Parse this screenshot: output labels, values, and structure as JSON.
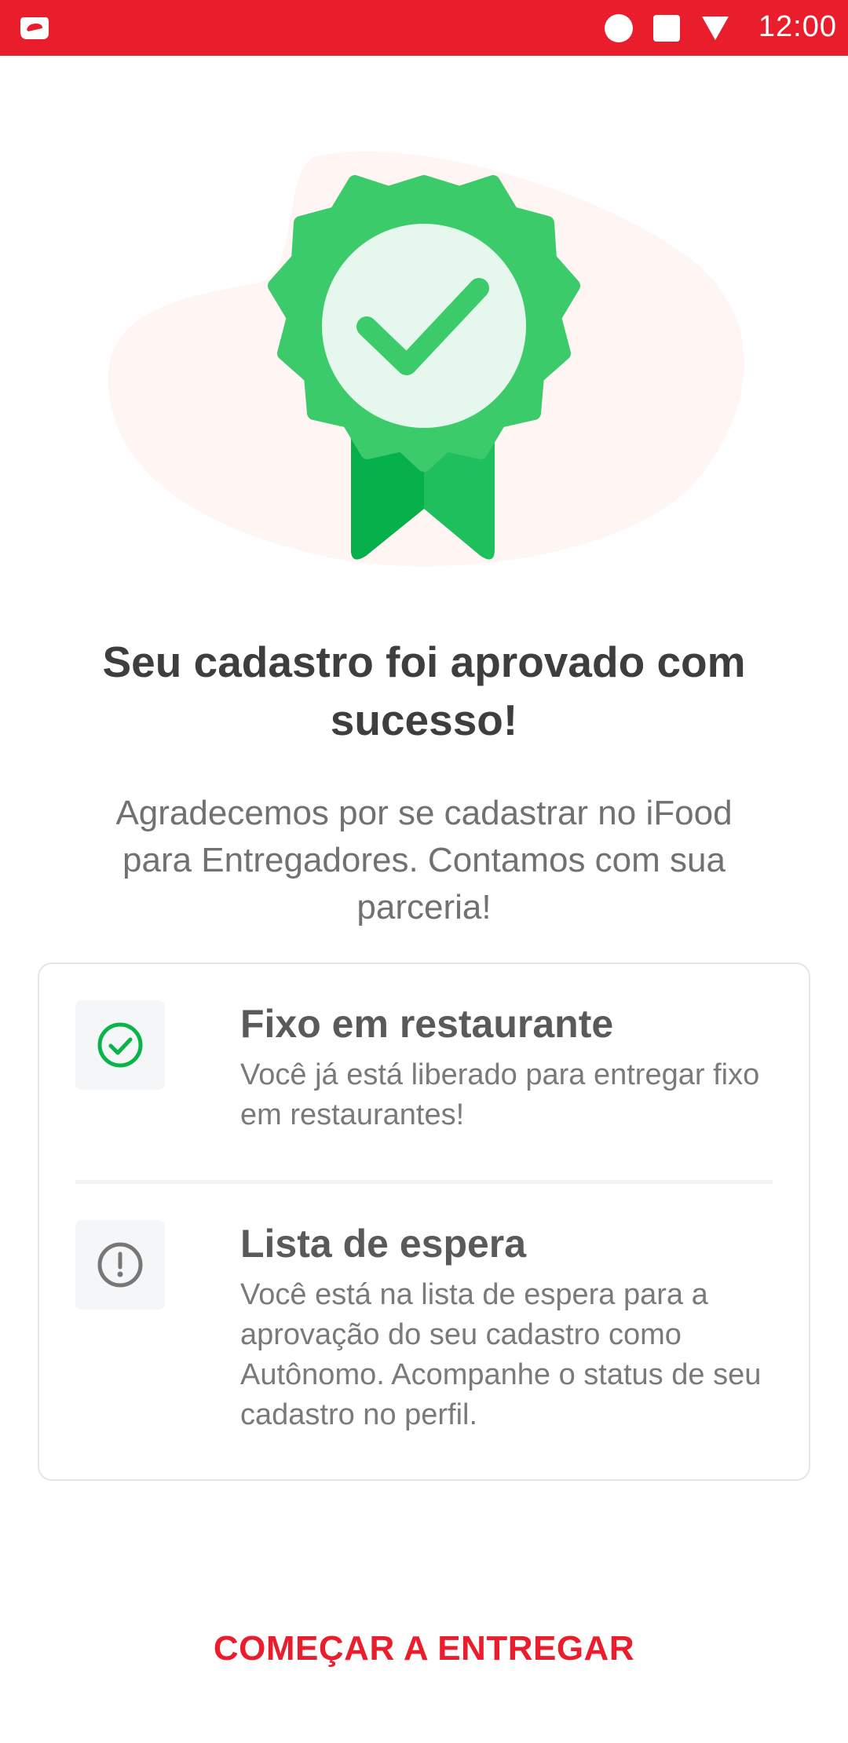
{
  "status_bar": {
    "time": "12:00",
    "background_color": "#EA1D2C"
  },
  "hero": {
    "icon": "approved-badge-icon",
    "badge_color": "#3CCB6B",
    "ribbon_color": "#1FBF5E"
  },
  "title": "Seu cadastro foi aprovado com sucesso!",
  "subtitle": "Agradecemos por se cadastrar no iFood para Entregadores. Contamos com sua parceria!",
  "items": [
    {
      "icon": "check-circle-icon",
      "title": "Fixo em restaurante",
      "description": "Você já está liberado para entregar fixo em restaurantes!"
    },
    {
      "icon": "alert-circle-icon",
      "title": "Lista de espera",
      "description": "Você está na lista de espera para a aprovação do seu cadastro como Autônomo. Acompanhe o status de seu cadastro no perfil."
    }
  ],
  "cta_label": "COMEÇAR A ENTREGAR",
  "accent_color": "#EA1D2C"
}
